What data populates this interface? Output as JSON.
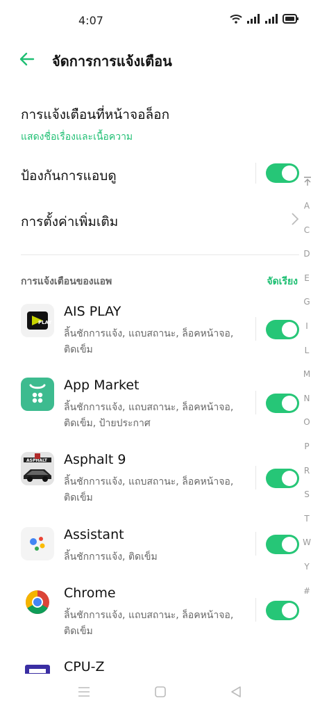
{
  "status": {
    "time": "4:07"
  },
  "header": {
    "title": "จัดการการแจ้งเตือน"
  },
  "lockscreen": {
    "title": "การแจ้งเตือนที่หน้าจอล็อก",
    "subtitle": "แสดงชื่อเรื่องและเนื้อความ"
  },
  "peek": {
    "title": "ป้องกันการแอบดู",
    "enabled": true
  },
  "more": {
    "title": "การตั้งค่าเพิ่มเติม"
  },
  "apps_section": {
    "label": "การแจ้งเตือนของแอพ",
    "sort_label": "จัดเรียง"
  },
  "apps": [
    {
      "name": "AIS PLAY",
      "desc": "ลิ้นชักการแจ้ง, แถบสถานะ, ล็อคหน้าจอ, ติดเข็ม",
      "enabled": true,
      "icon": "ais-play-icon"
    },
    {
      "name": "App Market",
      "desc": "ลิ้นชักการแจ้ง, แถบสถานะ, ล็อคหน้าจอ, ติดเข็ม, ป้ายประกาศ",
      "enabled": true,
      "icon": "app-market-icon"
    },
    {
      "name": "Asphalt 9",
      "desc": "ลิ้นชักการแจ้ง, แถบสถานะ, ล็อคหน้าจอ, ติดเข็ม",
      "enabled": true,
      "icon": "asphalt-icon"
    },
    {
      "name": "Assistant",
      "desc": "ลิ้นชักการแจ้ง, ติดเข็ม",
      "enabled": true,
      "icon": "assistant-icon"
    },
    {
      "name": "Chrome",
      "desc": "ลิ้นชักการแจ้ง, แถบสถานะ, ล็อคหน้าจอ, ติดเข็ม",
      "enabled": true,
      "icon": "chrome-icon"
    },
    {
      "name": "CPU-Z",
      "icon": "cpuz-icon"
    }
  ],
  "alphabet": [
    "A",
    "C",
    "D",
    "E",
    "G",
    "I",
    "L",
    "M",
    "N",
    "O",
    "P",
    "R",
    "S",
    "T",
    "W",
    "Y",
    "#"
  ],
  "colors": {
    "accent": "#26c677",
    "accent_text": "#1fbf73"
  }
}
